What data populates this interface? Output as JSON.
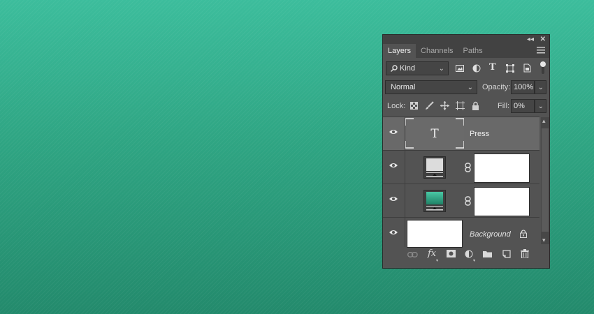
{
  "panel": {
    "tabs": [
      {
        "label": "Layers",
        "active": true
      },
      {
        "label": "Channels",
        "active": false
      },
      {
        "label": "Paths",
        "active": false
      }
    ],
    "filter": {
      "label": "Kind"
    },
    "blend_mode": "Normal",
    "opacity": {
      "label": "Opacity:",
      "value": "100%"
    },
    "lock": {
      "label": "Lock:"
    },
    "fill": {
      "label": "Fill:",
      "value": "0%"
    },
    "layers": [
      {
        "name": "Press",
        "type": "text",
        "selected": true
      },
      {
        "name": "",
        "type": "adjustment-with-mask"
      },
      {
        "name": "",
        "type": "gradient-fill-with-mask"
      },
      {
        "name": "Background",
        "type": "background",
        "locked": true
      }
    ],
    "footer_icons": [
      "link-icon",
      "fx-icon",
      "mask-icon",
      "adjustment-icon",
      "folder-icon",
      "new-layer-icon",
      "trash-icon"
    ]
  },
  "colors": {
    "canvas_top": "#3cbd9c",
    "canvas_bottom": "#238a6c",
    "panel_bg": "#535353",
    "selected_layer": "#696969"
  }
}
